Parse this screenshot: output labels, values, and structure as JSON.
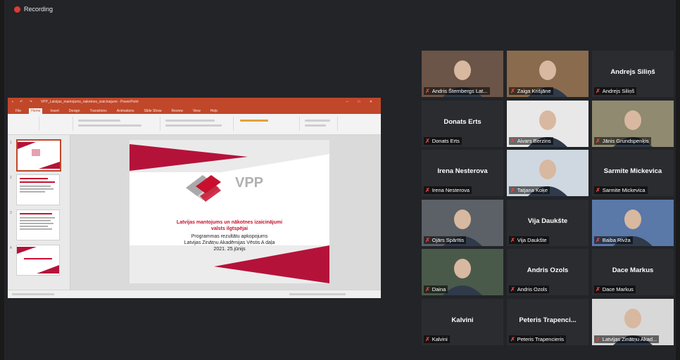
{
  "recording": {
    "label": "Recording"
  },
  "share": {
    "app_title": "VPP_Latvijas_mantojums_nakotnes_izaicinajumi - PowerPoint",
    "tabs": [
      "File",
      "Home",
      "Insert",
      "Design",
      "Transitions",
      "Animations",
      "Slide Show",
      "Review",
      "View",
      "Help"
    ],
    "active_tab": "Home",
    "slide": {
      "logo_text": "VPP",
      "title_line1": "Latvijas mantojums un nākotnes izaicinājumi",
      "title_line2": "valsts ilgtspējai",
      "line3": "Programmas rezultātu apkopojums",
      "line4": "Latvijas Zinātņu Akadēmijas Vēstis A daļa",
      "line5": "2021. 25.jūnijs"
    },
    "thumb_numbers": [
      "1",
      "2",
      "3",
      "4"
    ]
  },
  "participants": [
    {
      "name": "Andris Šternbergs Lat...",
      "video": true
    },
    {
      "name": "Zaiga Krišjāne",
      "video": true
    },
    {
      "name": "Andrejs Siliņš",
      "center": "Andrejs Siliņš",
      "video": false
    },
    {
      "name": "Donats Erts",
      "center": "Donats Erts",
      "video": false
    },
    {
      "name": "Aivars Berzins",
      "video": true
    },
    {
      "name": "Jānis Grundspenķis",
      "video": true
    },
    {
      "name": "Irena Nesterova",
      "center": "Irena Nesterova",
      "video": false
    },
    {
      "name": "Tatjana Koķe",
      "video": true
    },
    {
      "name": "Sarmite Mickevica",
      "center": "Sarmite Mickevica",
      "video": false
    },
    {
      "name": "Ojārs Spārītis",
      "video": true
    },
    {
      "name": "Vija Daukšte",
      "center": "Vija Daukšte",
      "video": false
    },
    {
      "name": "Baiba Rivža",
      "video": true
    },
    {
      "name": "Daina",
      "video": true
    },
    {
      "name": "Andris Ozols",
      "center": "Andris Ozols",
      "video": false
    },
    {
      "name": "Dace Markus",
      "center": "Dace Markus",
      "video": false
    },
    {
      "name": "Kalvini",
      "center": "Kalvini",
      "video": false
    },
    {
      "name": "Peteris Trapencieris",
      "center": "Peteris Trapenci...",
      "video": false
    },
    {
      "name": "Latvijas Zinātņu Akad...",
      "video": true
    }
  ],
  "colors": {
    "brand_red": "#c8102e",
    "ppt_orange": "#c0472a",
    "active_speaker": "#c9d64a",
    "mic_muted": "#e8453c"
  }
}
